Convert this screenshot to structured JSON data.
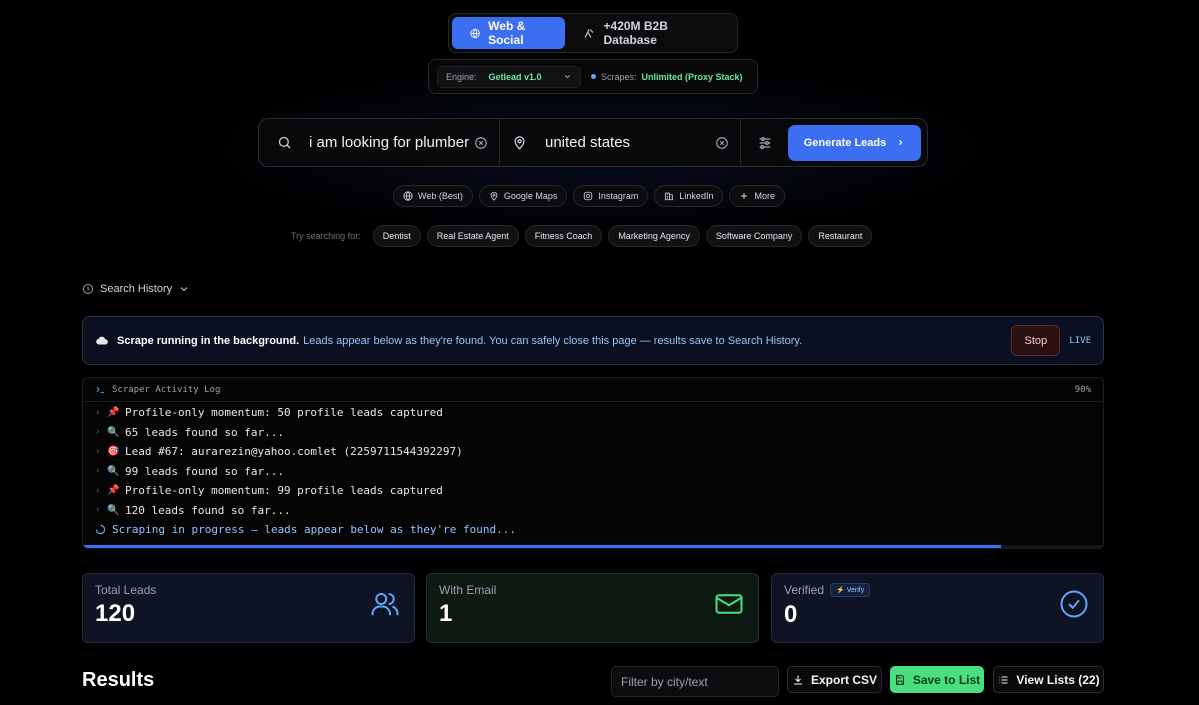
{
  "mode_switch": {
    "web_social_label": "Web & Social",
    "b2b_label": "+420M B2B Database"
  },
  "engine_bar": {
    "engine_label": "Engine:",
    "engine_value": "Getlead v1.0",
    "scrapes_label": "Scrapes:",
    "scrapes_value": "Unlimited (Proxy Stack)"
  },
  "search": {
    "query": "i am looking for plumber",
    "location": "united states",
    "generate_label": "Generate Leads"
  },
  "sources": [
    {
      "label": "Web (Best)",
      "icon": "globe-icon"
    },
    {
      "label": "Google Maps",
      "icon": "map-pin-icon"
    },
    {
      "label": "Instagram",
      "icon": "instagram-icon"
    },
    {
      "label": "LinkedIn",
      "icon": "building-icon"
    },
    {
      "label": "More",
      "icon": "plus-icon"
    }
  ],
  "suggestions": {
    "label": "Try searching for:",
    "items": [
      "Dentist",
      "Real Estate Agent",
      "Fitness Coach",
      "Marketing Agency",
      "Software Company",
      "Restaurant"
    ]
  },
  "history": {
    "label": "Search History"
  },
  "banner": {
    "strong": "Scrape running in the background.",
    "text": "Leads appear below as they're found. You can safely close this page — results save to Search History.",
    "stop_label": "Stop",
    "live_label": "LIVE"
  },
  "log": {
    "title": "Scraper Activity Log",
    "percent_label": "90%",
    "progress": 0.9,
    "lines": [
      {
        "emoji": "📌",
        "text": "Profile-only momentum: 50 profile leads captured"
      },
      {
        "emoji": "🔍",
        "text": "65 leads found so far..."
      },
      {
        "emoji": "🎯",
        "text": "Lead #67: aurarezin@yahoo.comlet (2259711544392297)"
      },
      {
        "emoji": "🔍",
        "text": "99 leads found so far..."
      },
      {
        "emoji": "📌",
        "text": "Profile-only momentum: 99 profile leads captured"
      },
      {
        "emoji": "🔍",
        "text": "120 leads found so far..."
      }
    ],
    "status": "Scraping in progress — leads appear below as they're found..."
  },
  "stats": {
    "total_label": "Total Leads",
    "total_value": "120",
    "email_label": "With Email",
    "email_value": "1",
    "verified_label": "Verified",
    "verify_badge": "Verify",
    "verified_value": "0"
  },
  "results": {
    "title": "Results",
    "filter_placeholder": "Filter by city/text",
    "export_label": "Export CSV",
    "save_label": "Save to List",
    "view_label": "View Lists (22)"
  },
  "colors": {
    "accent": "#3b6ef0",
    "success": "#4ade80",
    "engine_green": "#6ee7a6"
  }
}
